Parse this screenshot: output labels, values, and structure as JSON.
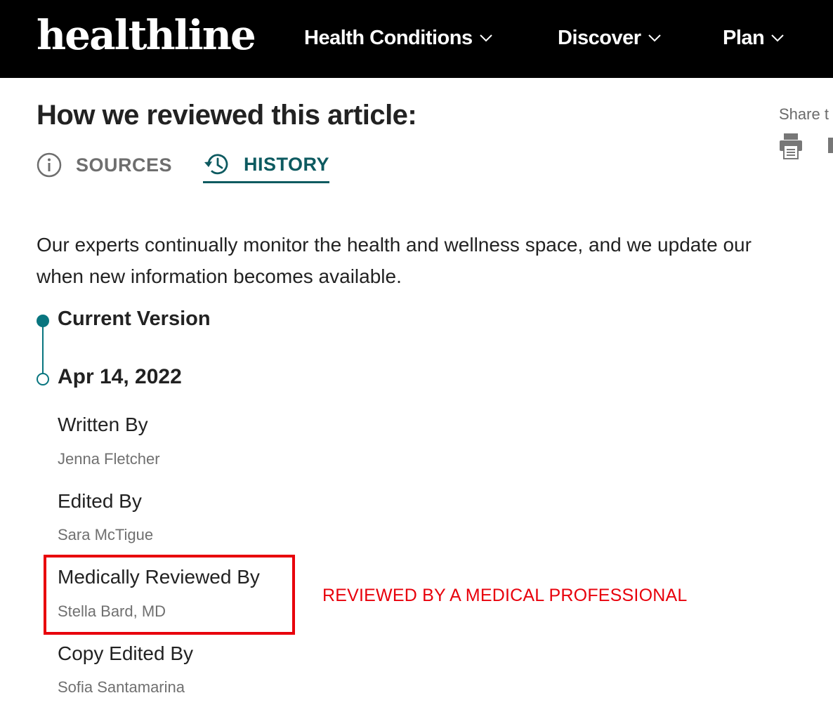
{
  "header": {
    "logo": "healthline",
    "nav": [
      {
        "label": "Health Conditions"
      },
      {
        "label": "Discover"
      },
      {
        "label": "Plan"
      }
    ]
  },
  "review": {
    "title": "How we reviewed this article:",
    "share_label": "Share t",
    "tabs": [
      {
        "label": "SOURCES",
        "icon": "info-icon",
        "active": false
      },
      {
        "label": "HISTORY",
        "icon": "history-icon",
        "active": true
      }
    ],
    "intro_lines": [
      "Our experts continually monitor the health and wellness space, and we update our",
      "when new information becomes available."
    ],
    "timeline": {
      "current_label": "Current Version",
      "date": "Apr 14, 2022"
    },
    "credits": [
      {
        "role": "Written By",
        "name": "Jenna Fletcher"
      },
      {
        "role": "Edited By",
        "name": "Sara McTigue"
      },
      {
        "role": "Medically Reviewed By",
        "name": "Stella Bard, MD"
      },
      {
        "role": "Copy Edited By",
        "name": "Sofia Santamarina"
      }
    ]
  },
  "annotation": {
    "text": "REVIEWED BY A MEDICAL PROFESSIONAL",
    "color": "#e8000b"
  },
  "colors": {
    "accent": "#0d5a60",
    "timeline": "#08757f",
    "header_bg": "#000000"
  }
}
